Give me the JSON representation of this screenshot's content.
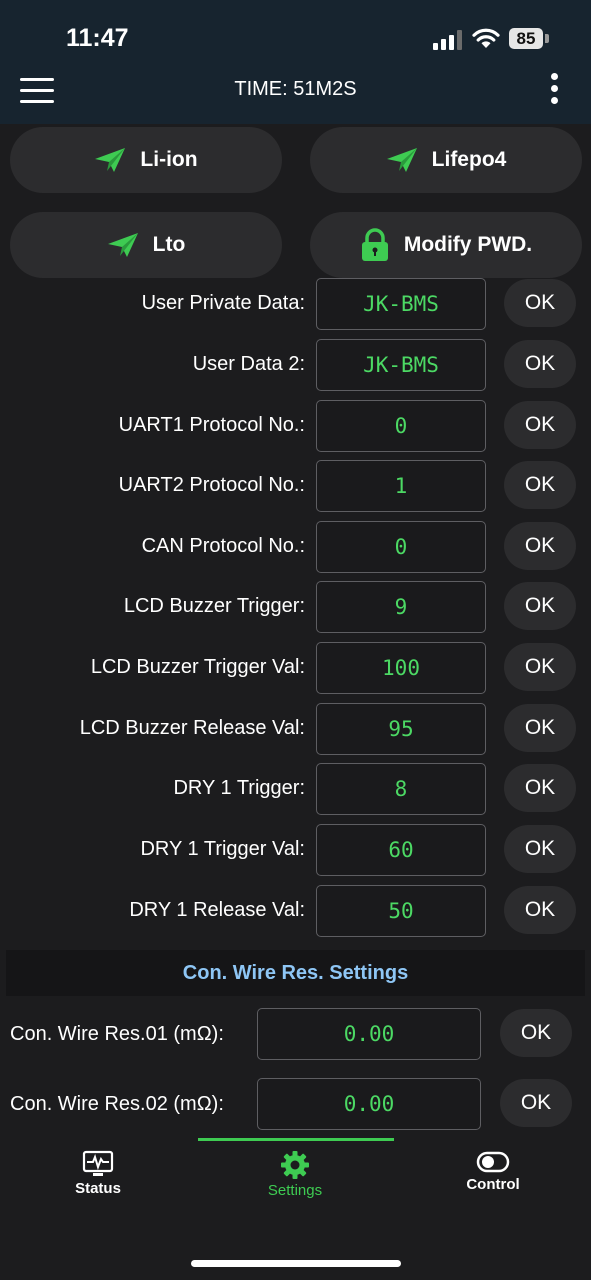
{
  "status_bar": {
    "time": "11:47",
    "battery": "85"
  },
  "app_bar": {
    "title": "TIME: 51M2S"
  },
  "presets": [
    {
      "label": "Li-ion",
      "icon": "paper-plane-icon"
    },
    {
      "label": "Lifepo4",
      "icon": "paper-plane-icon"
    },
    {
      "label": "Lto",
      "icon": "paper-plane-icon"
    },
    {
      "label": "Modify PWD.",
      "icon": "lock-icon"
    }
  ],
  "settings": [
    {
      "label": "User Private Data:",
      "value": "JK-BMS",
      "button": "OK"
    },
    {
      "label": "User Data 2:",
      "value": "JK-BMS",
      "button": "OK"
    },
    {
      "label": "UART1 Protocol No.:",
      "value": "0",
      "button": "OK"
    },
    {
      "label": "UART2 Protocol No.:",
      "value": "1",
      "button": "OK"
    },
    {
      "label": "CAN Protocol No.:",
      "value": "0",
      "button": "OK"
    },
    {
      "label": "LCD Buzzer Trigger:",
      "value": "9",
      "button": "OK"
    },
    {
      "label": "LCD Buzzer Trigger Val:",
      "value": "100",
      "button": "OK"
    },
    {
      "label": "LCD Buzzer Release Val:",
      "value": "95",
      "button": "OK"
    },
    {
      "label": "DRY 1 Trigger:",
      "value": "8",
      "button": "OK"
    },
    {
      "label": "DRY 1 Trigger Val:",
      "value": "60",
      "button": "OK"
    },
    {
      "label": "DRY 1 Release Val:",
      "value": "50",
      "button": "OK"
    }
  ],
  "wire_section": {
    "title": "Con. Wire Res. Settings",
    "rows": [
      {
        "label": "Con. Wire Res.01 (mΩ):",
        "value": "0.00",
        "button": "OK"
      },
      {
        "label": "Con. Wire Res.02 (mΩ):",
        "value": "0.00",
        "button": "OK"
      }
    ]
  },
  "bottom_nav": [
    {
      "label": "Status",
      "icon": "monitor-pulse-icon"
    },
    {
      "label": "Settings",
      "icon": "gear-icon",
      "active": true
    },
    {
      "label": "Control",
      "icon": "toggle-icon"
    }
  ],
  "colors": {
    "accent_green": "#3ecb52",
    "value_green": "#4cd964",
    "section_blue": "#8ec6f5",
    "header_bg": "#17242f"
  }
}
